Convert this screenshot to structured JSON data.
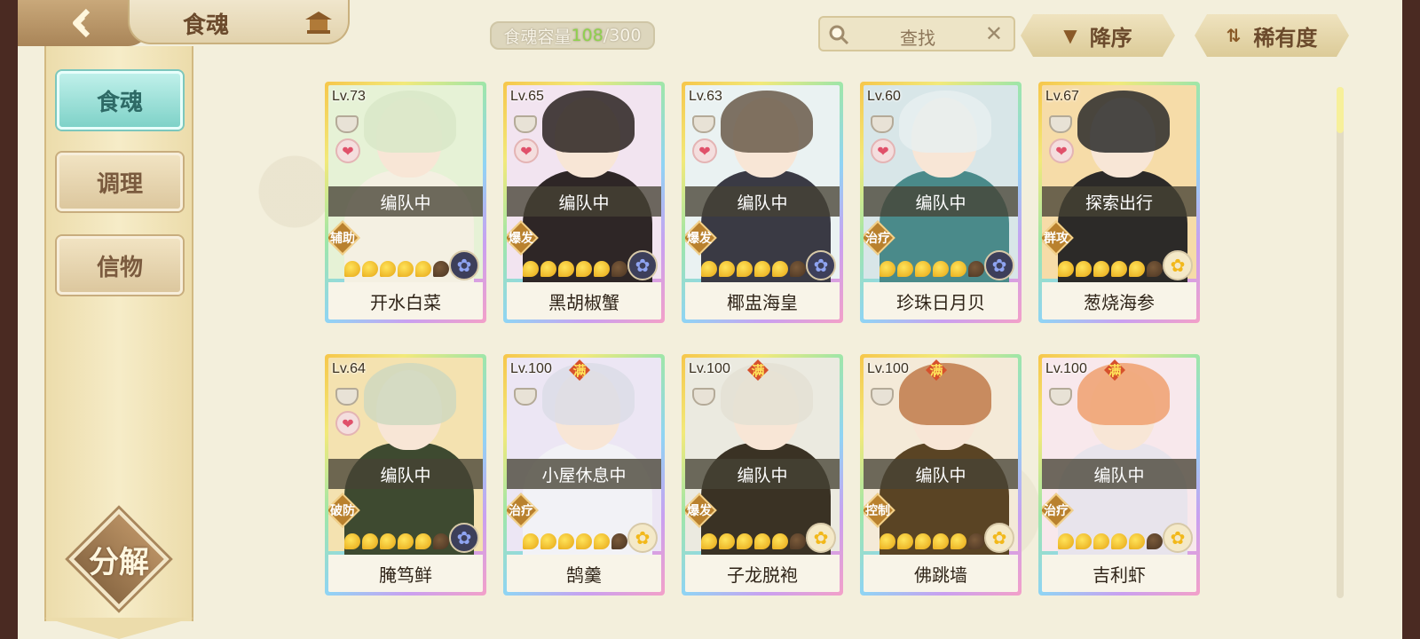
{
  "header": {
    "title": "食魂",
    "capacity_label": "食魂容量 ",
    "capacity_current": "108",
    "capacity_max": "/300",
    "search_label": "查找",
    "sort_order_label": "降序",
    "sort_rarity_label": "稀有度"
  },
  "sidebar": {
    "items": [
      {
        "label": "食魂",
        "active": true
      },
      {
        "label": "调理",
        "active": false
      },
      {
        "label": "信物",
        "active": false
      }
    ],
    "decompose_label": "分解"
  },
  "cards": [
    {
      "level": "Lv.73",
      "max": "",
      "status": "编队中",
      "role": "辅助",
      "name": "开水白菜",
      "stars": 5,
      "element": "dark",
      "heart": true,
      "bg": "#e6f2d6",
      "hair": "#d8e8c8",
      "body": "#f4f0e2"
    },
    {
      "level": "Lv.65",
      "max": "",
      "status": "编队中",
      "role": "爆发",
      "name": "黑胡椒蟹",
      "stars": 5,
      "element": "dark",
      "heart": true,
      "bg": "#f2e4f0",
      "hair": "#2a2220",
      "body": "#2e2626"
    },
    {
      "level": "Lv.63",
      "max": "",
      "status": "编队中",
      "role": "爆发",
      "name": "椰盅海皇",
      "stars": 5,
      "element": "dark",
      "heart": true,
      "bg": "#eaf2f2",
      "hair": "#6a5a4a",
      "body": "#3a3a44"
    },
    {
      "level": "Lv.60",
      "max": "",
      "status": "编队中",
      "role": "治疗",
      "name": "珍珠日月贝",
      "stars": 5,
      "element": "dark",
      "heart": true,
      "bg": "#d8e6e8",
      "hair": "#e8eef0",
      "body": "#4a8a8a"
    },
    {
      "level": "Lv.67",
      "max": "",
      "status": "探索出行",
      "role": "群攻",
      "name": "葱烧海参",
      "stars": 5,
      "element": "gold",
      "heart": true,
      "bg": "#f6dca8",
      "hair": "#2a2a2a",
      "body": "#2c2a28"
    },
    {
      "level": "Lv.64",
      "max": "",
      "status": "编队中",
      "role": "破防",
      "name": "腌笃鲜",
      "stars": 5,
      "element": "dark",
      "heart": true,
      "bg": "#f4e2b0",
      "hair": "#cfd8c0",
      "body": "#3e4a30"
    },
    {
      "level": "Lv.100",
      "max": "满",
      "status": "小屋休息中",
      "role": "治疗",
      "name": "鹄羹",
      "stars": 5,
      "element": "gold",
      "heart": false,
      "bg": "#ece6f4",
      "hair": "#dcdce6",
      "body": "#f2f2f6"
    },
    {
      "level": "Lv.100",
      "max": "满",
      "status": "编队中",
      "role": "爆发",
      "name": "子龙脱袍",
      "stars": 5,
      "element": "gold",
      "heart": false,
      "bg": "#ebeae0",
      "hair": "#e4e0d4",
      "body": "#3a3224"
    },
    {
      "level": "Lv.100",
      "max": "满",
      "status": "编队中",
      "role": "控制",
      "name": "佛跳墙",
      "stars": 5,
      "element": "gold",
      "heart": false,
      "bg": "#f4ead8",
      "hair": "#c07a4a",
      "body": "#5a4424"
    },
    {
      "level": "Lv.100",
      "max": "满",
      "status": "编队中",
      "role": "治疗",
      "name": "吉利虾",
      "stars": 5,
      "element": "gold",
      "heart": false,
      "bg": "#f8e8ec",
      "hair": "#f0a070",
      "body": "#e8e4ec"
    }
  ]
}
